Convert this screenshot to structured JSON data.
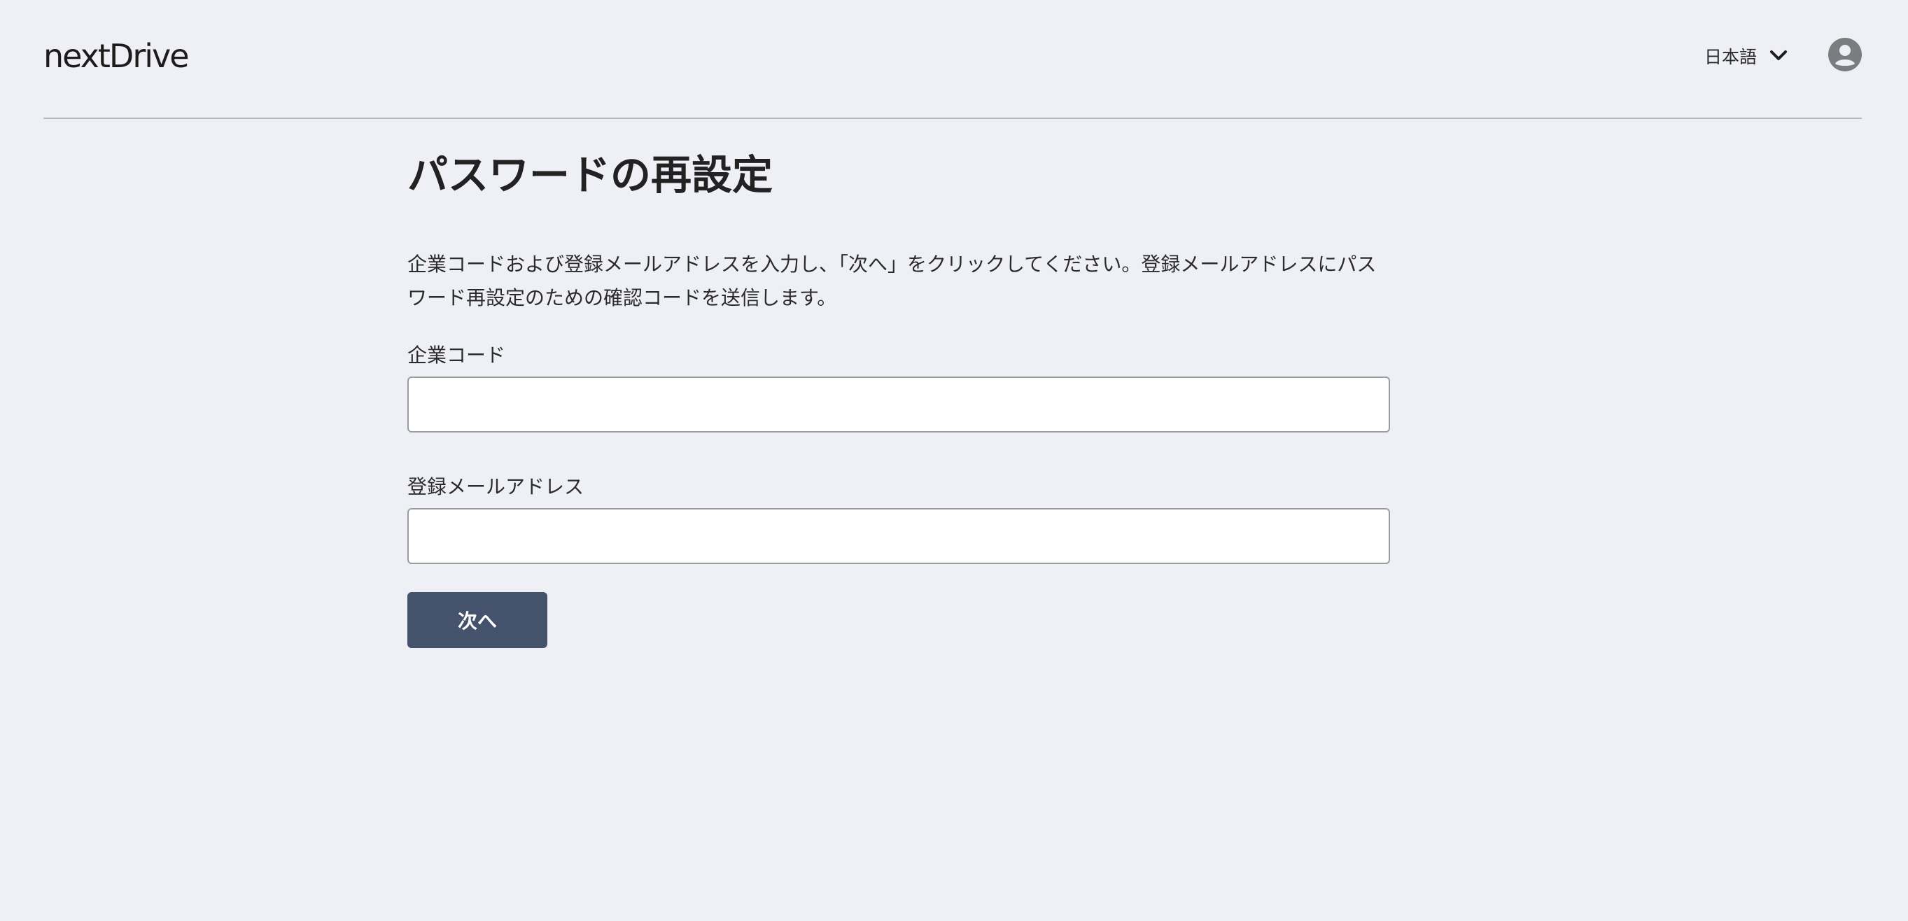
{
  "header": {
    "logo": "nextDrive",
    "language": {
      "selected": "日本語",
      "chevron_icon": "chevron-down-icon"
    },
    "user_icon": "user-circle-icon"
  },
  "main": {
    "title": "パスワードの再設定",
    "description": "企業コードおよび登録メールアドレスを入力し、「次へ」をクリックしてください。登録メールアドレスにパスワード再設定のための確認コードを送信します。",
    "company_code": {
      "label": "企業コード",
      "value": "",
      "placeholder": ""
    },
    "email": {
      "label": "登録メールアドレス",
      "value": "",
      "placeholder": ""
    },
    "next_button": "次へ"
  },
  "colors": {
    "background": "#eff0f5",
    "button": "#45526b",
    "divider": "#b6b9c1"
  }
}
